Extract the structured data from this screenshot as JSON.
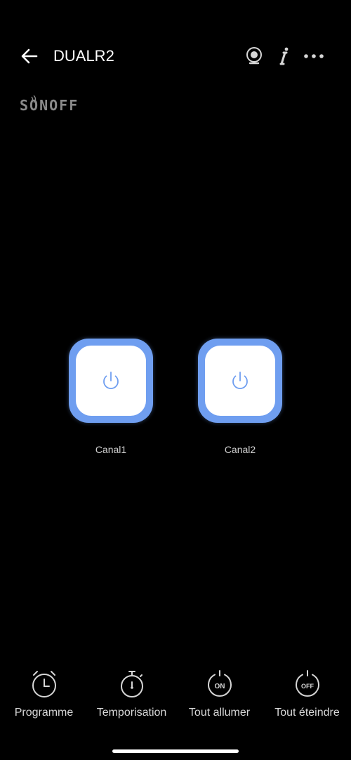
{
  "header": {
    "title": "DUALR2"
  },
  "brand": {
    "logo_text": "SONOFF"
  },
  "channels": [
    {
      "label": "Canal1",
      "state": "on",
      "icon": "power-icon"
    },
    {
      "label": "Canal2",
      "state": "on",
      "icon": "power-icon"
    }
  ],
  "bottom_bar": {
    "items": [
      {
        "label": "Programme",
        "icon": "clock-icon"
      },
      {
        "label": "Temporisation",
        "icon": "timer-icon"
      },
      {
        "label": "Tout allumer",
        "icon": "power-on-icon",
        "badge": "ON"
      },
      {
        "label": "Tout éteindre",
        "icon": "power-off-icon",
        "badge": "OFF"
      }
    ]
  },
  "colors": {
    "background": "#000000",
    "switch_accent": "#6f9ef0",
    "power_icon": "#6f9ef0",
    "text_primary": "#ffffff",
    "text_secondary": "#d0d0d0"
  }
}
